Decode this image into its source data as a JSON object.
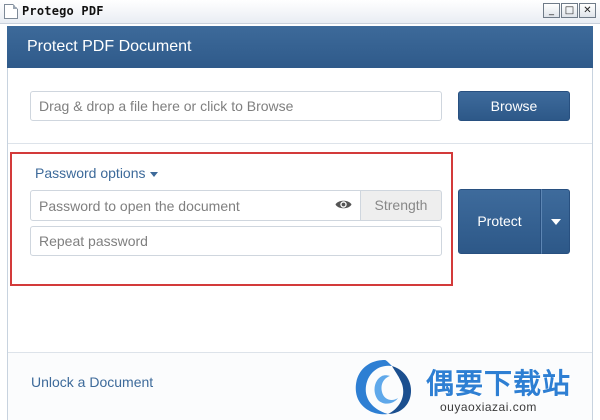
{
  "window": {
    "title": "Protego PDF",
    "minimize_label": "_",
    "maximize_label": "□",
    "close_label": "✕"
  },
  "header": {
    "title": "Protect PDF Document"
  },
  "file": {
    "placeholder": "Drag & drop a file here or click to Browse",
    "browse_label": "Browse"
  },
  "password": {
    "options_label": "Password options",
    "open_placeholder": "Password to open the document",
    "strength_label": "Strength",
    "repeat_placeholder": "Repeat password",
    "protect_label": "Protect"
  },
  "footer": {
    "unlock_label": "Unlock a Document"
  },
  "watermark": {
    "title": "偶要下载站",
    "url": "ouyaoxiazai.com"
  },
  "colors": {
    "accent": "#3d6a9a",
    "highlight": "#d33a3a",
    "watermark": "#2e7fd3"
  },
  "icons": {
    "eye": "eye-icon",
    "dropdown": "caret-down-icon",
    "app": "document-icon"
  }
}
